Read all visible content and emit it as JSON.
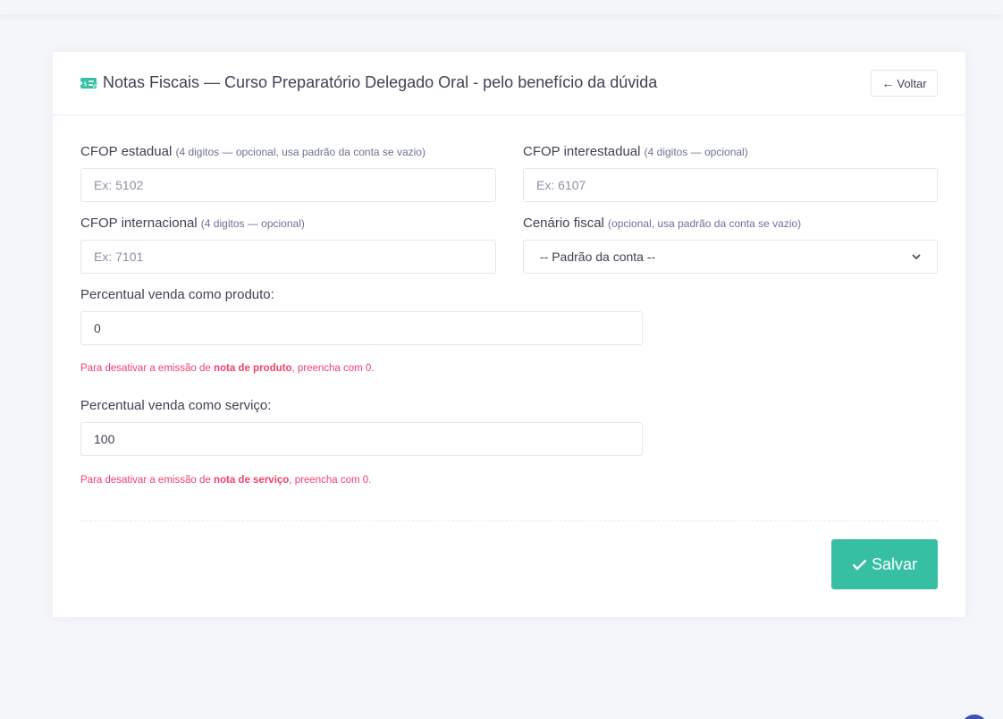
{
  "header": {
    "title": "Notas Fiscais — Curso Preparatório Delegado Oral - pelo benefício da dúvida",
    "back_label": "Voltar"
  },
  "form": {
    "cfop_estadual": {
      "label": "CFOP estadual",
      "hint": "(4 digitos — opcional, usa padrão da conta se vazio)",
      "placeholder": "Ex: 5102",
      "value": ""
    },
    "cfop_interestadual": {
      "label": "CFOP interestadual",
      "hint": "(4 digitos — opcional)",
      "placeholder": "Ex: 6107",
      "value": ""
    },
    "cfop_internacional": {
      "label": "CFOP internacional",
      "hint": "(4 digitos — opcional)",
      "placeholder": "Ex: 7101",
      "value": ""
    },
    "cenario_fiscal": {
      "label": "Cenário fiscal",
      "hint": "(opcional, usa padrão da conta se vazio)",
      "selected": "-- Padrão da conta --"
    },
    "percentual_produto": {
      "label": "Percentual venda como produto:",
      "value": "0",
      "help_prefix": "Para desativar a emissão de ",
      "help_bold": "nota de produto",
      "help_suffix": ", preencha com 0."
    },
    "percentual_servico": {
      "label": "Percentual venda como serviço:",
      "value": "100",
      "help_prefix": "Para desativar a emissão de ",
      "help_bold": "nota de serviço",
      "help_suffix": ", preencha com 0."
    }
  },
  "actions": {
    "save_label": "Salvar"
  },
  "colors": {
    "accent": "#36bfa3",
    "danger": "#f1416c",
    "background": "#f4f6f9"
  },
  "icons": {
    "title": "invoice-ticket-icon",
    "back": "arrow-left-icon",
    "save": "check-icon",
    "select": "chevron-down-icon"
  }
}
